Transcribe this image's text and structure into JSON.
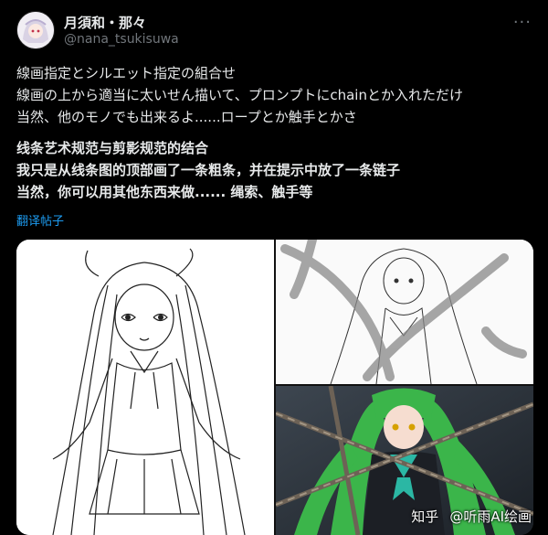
{
  "author": {
    "name": "月須和・那々",
    "handle": "@nana_tsukisuwa"
  },
  "post": {
    "japanese_lines": [
      "線画指定とシルエット指定の組合せ",
      "線画の上から適当に太いせん描いて、プロンプトにchainとか入れただけ",
      "当然、他のモノでも出来るよ......ロープとか触手とかさ"
    ],
    "chinese_lines": [
      "线条艺术规范与剪影规范的结合",
      "我只是从线条图的顶部画了一条粗条，并在提示中放了一条链子",
      "当然，你可以用其他东西来做...... 绳索、触手等"
    ],
    "translate_label": "翻译帖子"
  },
  "watermark": {
    "site": "知乎",
    "author": "@听雨AI绘画"
  },
  "colors": {
    "background": "#000000",
    "text": "#e7e9ea",
    "muted": "#71767b",
    "link": "#1d9bf0"
  }
}
